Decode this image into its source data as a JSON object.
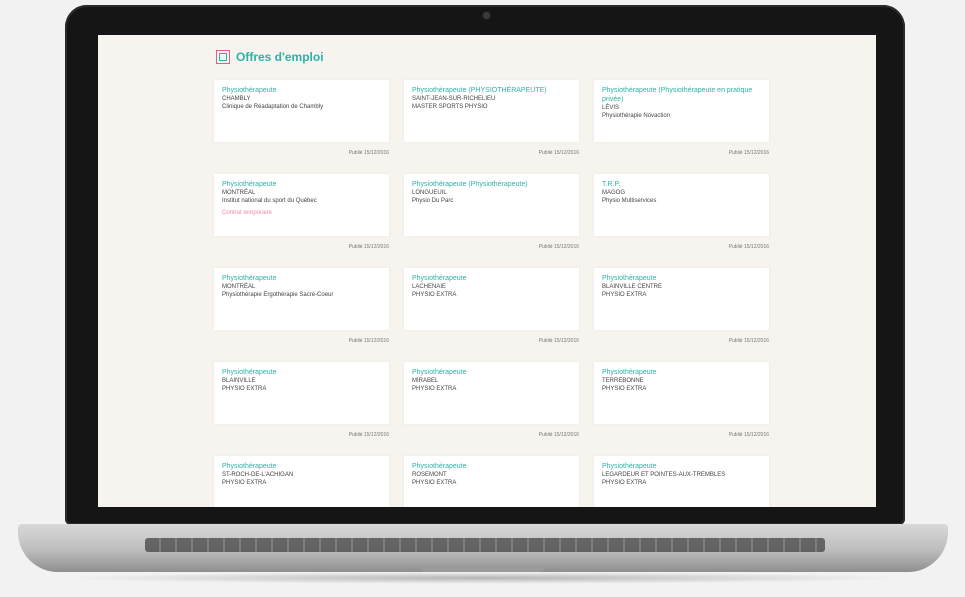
{
  "page": {
    "title": "Offres d'emploi"
  },
  "jobs": [
    {
      "title": "Physiothérapeute",
      "lines": [
        "CHAMBLY",
        "Clinique de Réadaptation de Chambly"
      ],
      "posted": "Publié 15/12/2016"
    },
    {
      "title": "Physiothérapeute (PHYSIOTHÉRAPEUTE)",
      "lines": [
        "SAINT-JEAN-SUR-RICHELIEU",
        "MASTER SPORTS PHYSIO"
      ],
      "posted": "Publié 15/12/2016"
    },
    {
      "title": "Physiothérapeute (Physiothérapeute en pratique privée)",
      "lines": [
        "LÉVIS",
        "Physiothérapie Novaction"
      ],
      "posted": "Publié 15/12/2016"
    },
    {
      "title": "Physiothérapeute",
      "lines": [
        "MONTRÉAL",
        "Institut national du sport du Québec"
      ],
      "note": "Contrat temporaire",
      "posted": "Publié 15/12/2016"
    },
    {
      "title": "Physiothérapeute (Physiothérapeute)",
      "lines": [
        "LONGUEUIL",
        "Physio Du Parc"
      ],
      "posted": "Publié 15/12/2016"
    },
    {
      "title": "T.R.P.",
      "lines": [
        "MAGOG",
        "Physio Multiservices"
      ],
      "posted": "Publié 15/12/2016"
    },
    {
      "title": "Physiothérapeute",
      "lines": [
        "MONTRÉAL",
        "Physiothérapie Ergothérapie Sacré-Coeur"
      ],
      "posted": "Publié 15/12/2016"
    },
    {
      "title": "Physiothérapeute",
      "lines": [
        "LACHENAIE",
        "PHYSIO EXTRA"
      ],
      "posted": "Publié 15/12/2016"
    },
    {
      "title": "Physiothérapeute",
      "lines": [
        "BLAINVILLE CENTRE",
        "PHYSIO EXTRA"
      ],
      "posted": "Publié 15/12/2016"
    },
    {
      "title": "Physiothérapeute",
      "lines": [
        "BLAINVILLE",
        "PHYSIO EXTRA"
      ],
      "posted": "Publié 15/12/2016"
    },
    {
      "title": "Physiothérapeute",
      "lines": [
        "MIRABEL",
        "PHYSIO EXTRA"
      ],
      "posted": "Publié 15/12/2016"
    },
    {
      "title": "Physiothérapeute",
      "lines": [
        "TERREBONNE",
        "PHYSIO EXTRA"
      ],
      "posted": "Publié 15/12/2016"
    },
    {
      "title": "Physiothérapeute",
      "lines": [
        "ST-ROCH-DE-L'ACHIGAN",
        "PHYSIO EXTRA"
      ],
      "posted": ""
    },
    {
      "title": "Physiothérapeute",
      "lines": [
        "ROSEMONT",
        "PHYSIO EXTRA"
      ],
      "posted": ""
    },
    {
      "title": "Physiothérapeute",
      "lines": [
        "LEGARDEUR ET POINTES-AUX-TREMBLES",
        "PHYSIO EXTRA"
      ],
      "posted": ""
    }
  ]
}
